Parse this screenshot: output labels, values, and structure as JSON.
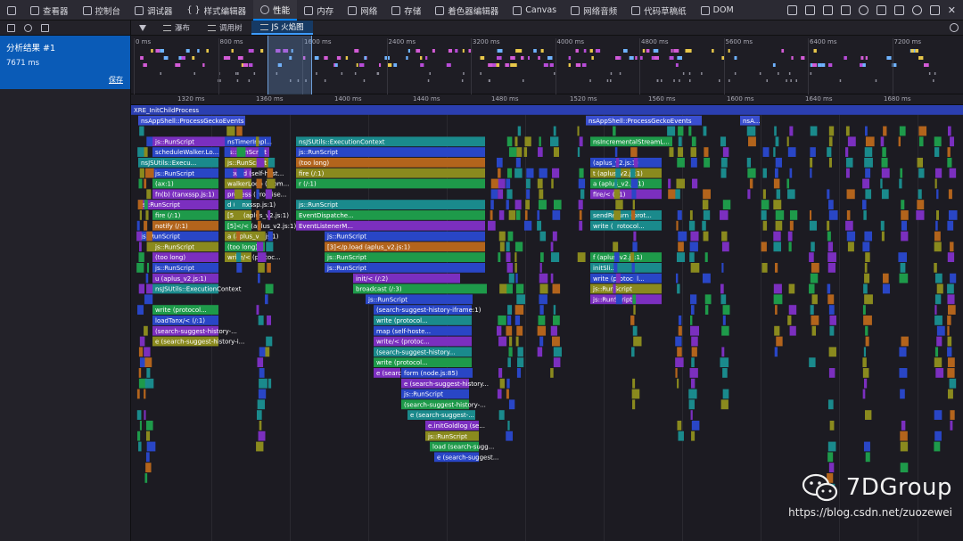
{
  "toolbar": {
    "tabs": [
      {
        "label": "查看器",
        "icon": "inspector-icon"
      },
      {
        "label": "控制台",
        "icon": "console-icon"
      },
      {
        "label": "调试器",
        "icon": "debugger-icon"
      },
      {
        "label": "样式编辑器",
        "icon": "braces-icon"
      },
      {
        "label": "性能",
        "icon": "performance-icon"
      },
      {
        "label": "内存",
        "icon": "memory-icon"
      },
      {
        "label": "网络",
        "icon": "network-icon"
      },
      {
        "label": "存储",
        "icon": "storage-icon"
      },
      {
        "label": "着色器编辑器",
        "icon": "shader-icon"
      },
      {
        "label": "Canvas",
        "icon": "canvas-icon"
      },
      {
        "label": "网络音频",
        "icon": "audio-icon"
      },
      {
        "label": "代码草稿纸",
        "icon": "scratchpad-icon"
      },
      {
        "label": "DOM",
        "icon": "dom-icon"
      }
    ],
    "selected_index": 4
  },
  "sidebar": {
    "recording_name": "分析结果 #1",
    "duration": "7671 ms",
    "save_label": "保存"
  },
  "subtabs": {
    "items": [
      "瀑布",
      "调用树",
      "JS 火焰图"
    ],
    "selected_index": 2
  },
  "overview": {
    "ticks": [
      "0 ms",
      "800 ms",
      "1600 ms",
      "2400 ms",
      "3200 ms",
      "4000 ms",
      "4800 ms",
      "5600 ms",
      "6400 ms",
      "7200 ms"
    ]
  },
  "flame": {
    "ticks": [
      "1320 ms",
      "1360 ms",
      "1400 ms",
      "1440 ms",
      "1480 ms",
      "1520 ms",
      "1560 ms",
      "1600 ms",
      "1640 ms",
      "1680 ms"
    ],
    "root_label": "XRE_InitChildProcess",
    "frames": [
      {
        "label": "nsAppShell::ProcessGeckoEvents"
      },
      {
        "label": "nsAppShell::ProcessGeckoEvents"
      },
      {
        "label": "nsA..."
      },
      {
        "label": "js::RunScript"
      },
      {
        "label": "nsTimerImpl..."
      },
      {
        "label": "nsJSUtils::ExecutionContext"
      },
      {
        "label": "nsIncrementalStreamL..."
      },
      {
        "label": "scheduleWalker.Lo..."
      },
      {
        "label": "js::RunScript"
      },
      {
        "label": "js::RunScript"
      },
      {
        "label": "nsJSUtils::Execu..."
      },
      {
        "label": "js::RunScript"
      },
      {
        "label": "(too long)"
      },
      {
        "label": "(aplus_v2.js:1)"
      },
      {
        "label": "js::RunScript"
      },
      {
        "label": "bound (self-host..."
      },
      {
        "label": "fire (/:1)"
      },
      {
        "label": "t (aplus_v2.js:1)"
      },
      {
        "label": "(ax:1)"
      },
      {
        "label": "walkerLoop (Prom..."
      },
      {
        "label": "r (/:1)"
      },
      {
        "label": "a (aplus_v2.js:1)"
      },
      {
        "label": "fn(b) (tanxssp.js:1)"
      },
      {
        "label": "process (Promise..."
      },
      {
        "label": "fire/< (/:1)"
      },
      {
        "label": "js::RunScript"
      },
      {
        "label": "d (tanxssp.js:1)"
      },
      {
        "label": "js::RunScript"
      },
      {
        "label": "fire (/:1)"
      },
      {
        "label": "[5]< (aplus_v2.js:1)"
      },
      {
        "label": "EventDispatche..."
      },
      {
        "label": "sendReturn (prot..."
      },
      {
        "label": "notify (/:1)"
      },
      {
        "label": "[5]</< (aplus_v2.js:1)"
      },
      {
        "label": "EventListenerM..."
      },
      {
        "label": "write (protocol..."
      },
      {
        "label": "js::RunScript"
      },
      {
        "label": "a (aplus_v2.js:1)"
      },
      {
        "label": "js::RunScript"
      },
      {
        "label": "js::RunScript"
      },
      {
        "label": "(too long)"
      },
      {
        "label": "[3]</p.load (aplus_v2.js:1)"
      },
      {
        "label": "(too long)"
      },
      {
        "label": "write/< (protoc..."
      },
      {
        "label": "js::RunScript"
      },
      {
        "label": "f (aplus_v2.js:1)"
      },
      {
        "label": "js::RunScript"
      },
      {
        "label": "js::RunScript"
      },
      {
        "label": "initSli..."
      },
      {
        "label": "u (aplus_v2.js:1)"
      },
      {
        "label": "init/< (/:2)"
      },
      {
        "label": "write (protocol..."
      },
      {
        "label": "nsJSUtils::ExecutionContext"
      },
      {
        "label": "broadcast (/:3)"
      },
      {
        "label": "js::RunScript"
      },
      {
        "label": "js::RunScript"
      },
      {
        "label": "js::RunScript"
      },
      {
        "label": "write (protocol..."
      },
      {
        "label": "(search-suggest-history-iframe:1)"
      },
      {
        "label": "loadTanx/< (/:1)"
      },
      {
        "label": "write (protocol..."
      },
      {
        "label": "(search-suggest-history-..."
      },
      {
        "label": "map (self-hoste..."
      },
      {
        "label": "e (search-suggest-history-i..."
      },
      {
        "label": "write/< (protoc..."
      },
      {
        "label": "(search-suggest-history..."
      },
      {
        "label": "write (protocol..."
      },
      {
        "label": "e (search-suggest-history..."
      },
      {
        "label": "form (node.js:85)"
      },
      {
        "label": "e (search-suggest-history..."
      },
      {
        "label": "js::RunScript"
      },
      {
        "label": "(search-suggest-history-..."
      },
      {
        "label": "e (search-suggest-..."
      },
      {
        "label": "e.initGoldlog (se..."
      },
      {
        "label": "js::RunScript"
      },
      {
        "label": "load (search-sugg..."
      },
      {
        "label": "e (search-suggest..."
      },
      {
        "label": "e.init (search-s..."
      },
      {
        "label": "sendPV (sea..."
      },
      {
        "label": "_sendPV (se..."
      },
      {
        "label": "t.prototype...."
      },
      {
        "label": "o.prototy..."
      },
      {
        "label": "d (search..."
      }
    ]
  },
  "watermark": {
    "brand": "7DGroup",
    "url": "https://blog.csdn.net/zuozewei"
  },
  "colors": {
    "accent": "#0a84ff",
    "selected_recording": "#0a5bb7",
    "frame_blue": "#2946c6",
    "frame_purple": "#7b2fbf",
    "frame_green": "#1e9a4a",
    "frame_teal": "#1a8a8c",
    "frame_olive": "#8a8a1e",
    "frame_orange": "#b3641c"
  }
}
